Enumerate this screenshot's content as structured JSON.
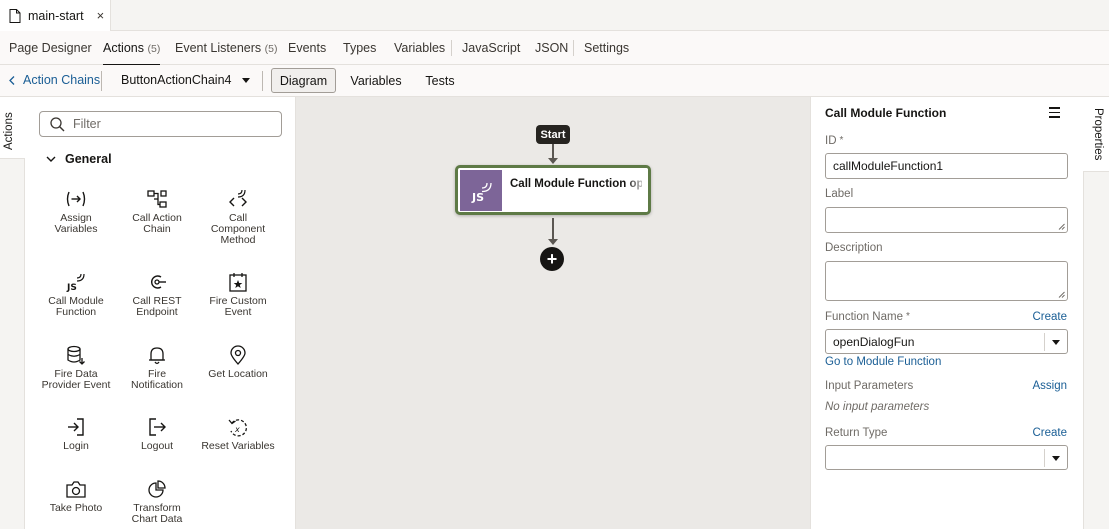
{
  "file_tab": {
    "name": "main-start",
    "close_symbol": "×"
  },
  "nav": {
    "tabs": [
      {
        "label": "Page Designer",
        "count": ""
      },
      {
        "label": "Actions",
        "count": "(5)"
      },
      {
        "label": "Event Listeners",
        "count": "(5)"
      },
      {
        "label": "Events",
        "count": ""
      },
      {
        "label": "Types",
        "count": ""
      },
      {
        "label": "Variables",
        "count": ""
      },
      {
        "label": "JavaScript",
        "count": ""
      },
      {
        "label": "JSON",
        "count": ""
      },
      {
        "label": "Settings",
        "count": ""
      }
    ],
    "active": "Actions"
  },
  "toolbar": {
    "back_label": "Action Chains",
    "chain_name": "ButtonActionChain4",
    "views": [
      "Diagram",
      "Variables",
      "Tests"
    ],
    "selected_view": "Diagram"
  },
  "left_strip": {
    "label": "Actions"
  },
  "palette": {
    "filter_placeholder": "Filter",
    "section": "General",
    "items": [
      {
        "line1": "Assign",
        "line2": "Variables",
        "line3": "",
        "icon": "assign-variables-icon"
      },
      {
        "line1": "Call Action",
        "line2": "Chain",
        "line3": "",
        "icon": "call-action-chain-icon"
      },
      {
        "line1": "Call",
        "line2": "Component",
        "line3": "Method",
        "icon": "call-component-method-icon"
      },
      {
        "line1": "Call Module",
        "line2": "Function",
        "line3": "",
        "icon": "call-module-function-icon"
      },
      {
        "line1": "Call REST",
        "line2": "Endpoint",
        "line3": "",
        "icon": "call-rest-endpoint-icon"
      },
      {
        "line1": "Fire Custom",
        "line2": "Event",
        "line3": "",
        "icon": "fire-custom-event-icon"
      },
      {
        "line1": "Fire Data",
        "line2": "Provider Event",
        "line3": "",
        "icon": "fire-data-provider-event-icon"
      },
      {
        "line1": "Fire",
        "line2": "Notification",
        "line3": "",
        "icon": "fire-notification-icon"
      },
      {
        "line1": "Get Location",
        "line2": "",
        "line3": "",
        "icon": "get-location-icon"
      },
      {
        "line1": "Login",
        "line2": "",
        "line3": "",
        "icon": "login-icon"
      },
      {
        "line1": "Logout",
        "line2": "",
        "line3": "",
        "icon": "logout-icon"
      },
      {
        "line1": "Reset Variables",
        "line2": "",
        "line3": "",
        "icon": "reset-variables-icon"
      },
      {
        "line1": "Take Photo",
        "line2": "",
        "line3": "",
        "icon": "take-photo-icon"
      },
      {
        "line1": "Transform",
        "line2": "Chart Data",
        "line3": "",
        "icon": "transform-chart-data-icon"
      }
    ]
  },
  "canvas": {
    "start_label": "Start",
    "node_title": "Call Module Function openDialogFun",
    "node_icon_text": "JS",
    "add_symbol": "+"
  },
  "properties": {
    "title": "Call Module Function",
    "id_label": "ID",
    "id_value": "callModuleFunction1",
    "label_label": "Label",
    "label_value": "",
    "description_label": "Description",
    "description_value": "",
    "function_name_label": "Function Name",
    "function_name_value": "openDialogFun",
    "create_link": "Create",
    "go_to_link": "Go to Module Function",
    "input_params_label": "Input Parameters",
    "assign_link": "Assign",
    "no_params_text": "No input parameters",
    "return_type_label": "Return Type",
    "return_type_value": "",
    "required_mark": "*"
  },
  "right_strip": {
    "label": "Properties"
  },
  "colors": {
    "link": "#1a5e95",
    "node_border": "#5e7a46",
    "js_tile": "#7d6598",
    "canvas_bg": "#ebe9e6"
  }
}
